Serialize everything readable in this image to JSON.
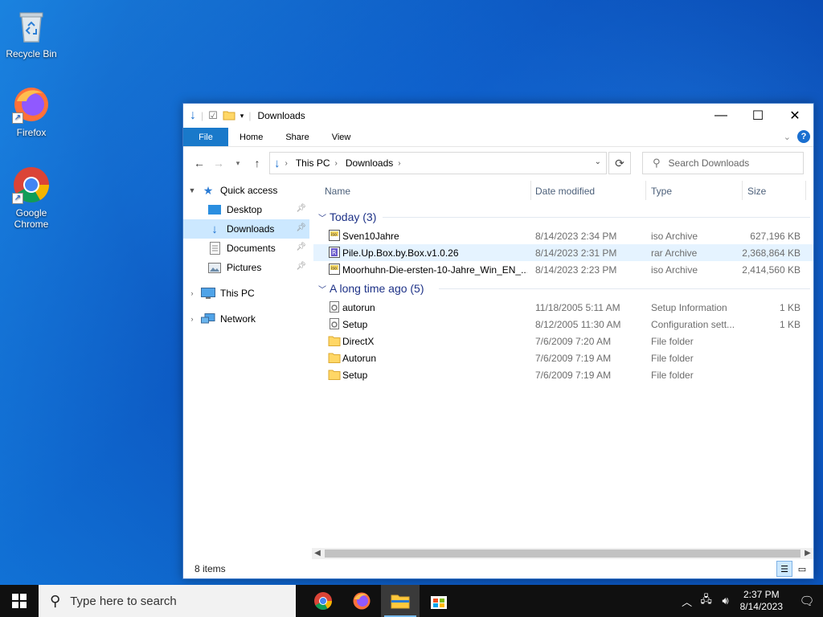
{
  "desktop": {
    "icons": [
      {
        "label": "Recycle Bin",
        "icon": "recycle-bin-icon"
      },
      {
        "label": "Firefox",
        "icon": "firefox-icon"
      },
      {
        "label": "Google Chrome",
        "icon": "chrome-icon"
      }
    ]
  },
  "window": {
    "title": "Downloads",
    "controls": {
      "minimize": "—",
      "maximize": "☐",
      "close": "✕"
    },
    "ribbon_tabs": [
      "File",
      "Home",
      "Share",
      "View"
    ],
    "breadcrumb": [
      "This PC",
      "Downloads"
    ],
    "search_placeholder": "Search Downloads",
    "nav_pane": [
      {
        "label": "Quick access",
        "icon": "star-icon",
        "expanded": true
      },
      {
        "label": "Desktop",
        "icon": "desktop-folder-icon",
        "pinned": true
      },
      {
        "label": "Downloads",
        "icon": "downloads-folder-icon",
        "pinned": true,
        "selected": true
      },
      {
        "label": "Documents",
        "icon": "documents-folder-icon",
        "pinned": true
      },
      {
        "label": "Pictures",
        "icon": "pictures-folder-icon",
        "pinned": true
      },
      {
        "label": "This PC",
        "icon": "computer-icon"
      },
      {
        "label": "Network",
        "icon": "network-icon"
      }
    ],
    "columns": [
      "Name",
      "Date modified",
      "Type",
      "Size"
    ],
    "groups": [
      {
        "label": "Today (3)",
        "files": [
          {
            "name": "Sven10Jahre",
            "date": "8/14/2023 2:34 PM",
            "type": "iso Archive",
            "size": "627,196 KB",
            "icon": "iso-file-icon"
          },
          {
            "name": "Pile.Up.Box.by.Box.v1.0.26",
            "date": "8/14/2023 2:31 PM",
            "type": "rar Archive",
            "size": "2,368,864 KB",
            "icon": "rar-file-icon"
          },
          {
            "name": "Moorhuhn-Die-ersten-10-Jahre_Win_EN_...",
            "date": "8/14/2023 2:23 PM",
            "type": "iso Archive",
            "size": "2,414,560 KB",
            "icon": "iso-file-icon"
          }
        ]
      },
      {
        "label": "A long time ago (5)",
        "files": [
          {
            "name": "autorun",
            "date": "11/18/2005 5:11 AM",
            "type": "Setup Information",
            "size": "1 KB",
            "icon": "settings-file-icon"
          },
          {
            "name": "Setup",
            "date": "8/12/2005 11:30 AM",
            "type": "Configuration sett...",
            "size": "1 KB",
            "icon": "settings-file-icon"
          },
          {
            "name": "DirectX",
            "date": "7/6/2009 7:20 AM",
            "type": "File folder",
            "size": "",
            "icon": "folder-icon"
          },
          {
            "name": "Autorun",
            "date": "7/6/2009 7:19 AM",
            "type": "File folder",
            "size": "",
            "icon": "folder-icon"
          },
          {
            "name": "Setup",
            "date": "7/6/2009 7:19 AM",
            "type": "File folder",
            "size": "",
            "icon": "folder-icon"
          }
        ]
      }
    ],
    "status": "8 items"
  },
  "taskbar": {
    "search_placeholder": "Type here to search",
    "apps": [
      "chrome-icon",
      "firefox-icon",
      "file-explorer-icon",
      "store-icon"
    ],
    "clock": {
      "time": "2:37 PM",
      "date": "8/14/2023"
    }
  },
  "colors": {
    "accent": "#1979ca",
    "selection": "#cce8ff",
    "hover": "#e5f3ff",
    "group_header": "#1e3287"
  }
}
